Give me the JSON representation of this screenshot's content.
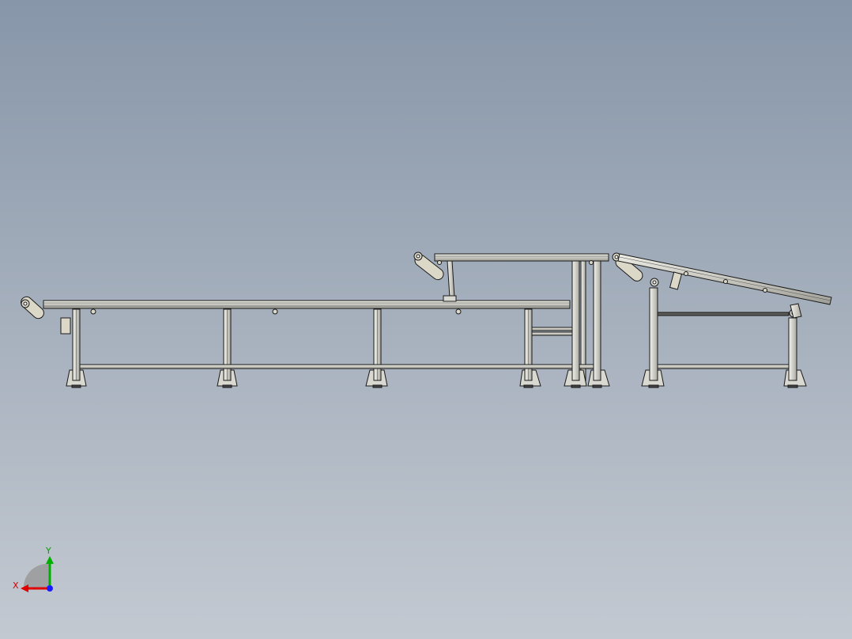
{
  "viewport": {
    "background_top": "#8796a9",
    "background_bottom": "#c3c9d1"
  },
  "model": {
    "line_color": "#1a1a1a",
    "metal_fill": "#d9d9d2",
    "roller_fill": "#dcd8c8",
    "shadow_fill": "#8c8c86"
  },
  "triad": {
    "x_label": "X",
    "y_label": "Y",
    "x_color": "#e00000",
    "y_color": "#00b000",
    "z_color": "#1a1aff"
  }
}
